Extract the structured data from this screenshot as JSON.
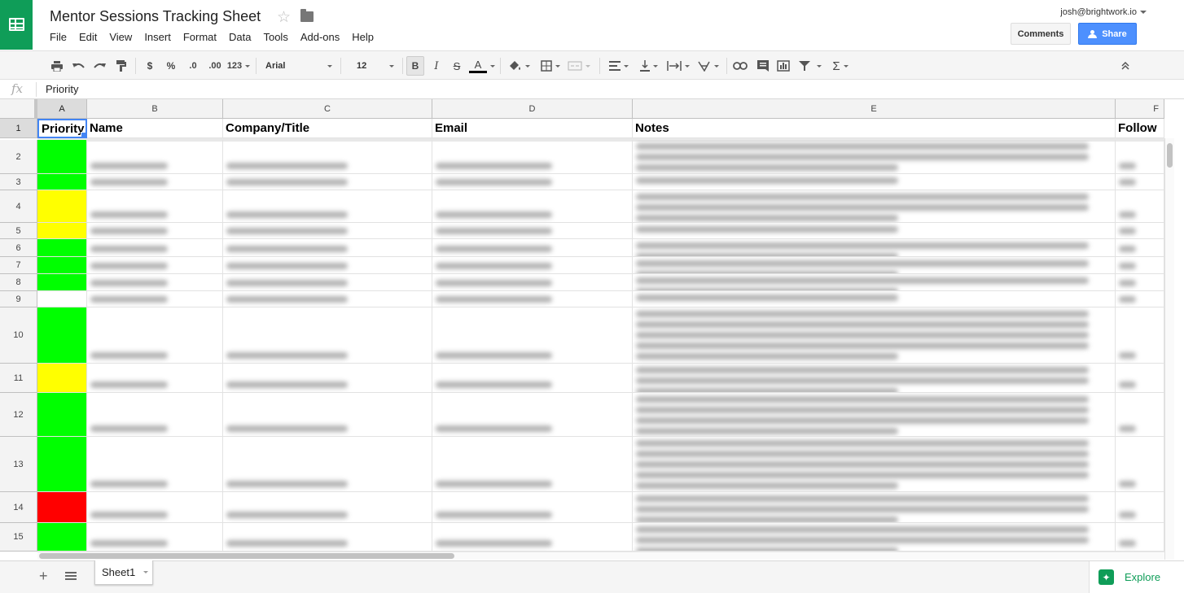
{
  "app": {
    "title": "Mentor Sessions Tracking Sheet",
    "account_email": "josh@brightwork.io",
    "comments_label": "Comments",
    "share_label": "Share"
  },
  "menu": [
    "File",
    "Edit",
    "View",
    "Insert",
    "Format",
    "Data",
    "Tools",
    "Add-ons",
    "Help"
  ],
  "toolbar": {
    "currency": "$",
    "percent": "%",
    "decimal_decrease": ".0",
    "decimal_increase": ".00",
    "more_formats": "123",
    "font": "Arial",
    "font_size": "12",
    "bold": "B",
    "italic": "I",
    "strikethrough": "S",
    "text_color": "A",
    "functions": "Σ"
  },
  "formula_bar": {
    "fx": "fx",
    "value": "Priority"
  },
  "columns": [
    "A",
    "B",
    "C",
    "D",
    "E",
    "F"
  ],
  "header_row": [
    "Priority",
    "Name",
    "Company/Title",
    "Email",
    "Notes",
    "Follow"
  ],
  "row_numbers": [
    "1",
    "2",
    "3",
    "4",
    "5",
    "6",
    "7",
    "8",
    "9",
    "10",
    "11",
    "12",
    "13",
    "14",
    "15"
  ],
  "priority_colors": {
    "green": "#00ff00",
    "yellow": "#ffff00",
    "red": "#ff0000",
    "none": "#ffffff"
  },
  "rows": [
    {
      "priority": "green"
    },
    {
      "priority": "green"
    },
    {
      "priority": "yellow"
    },
    {
      "priority": "yellow"
    },
    {
      "priority": "green"
    },
    {
      "priority": "green"
    },
    {
      "priority": "green"
    },
    {
      "priority": "none"
    },
    {
      "priority": "green"
    },
    {
      "priority": "yellow"
    },
    {
      "priority": "green"
    },
    {
      "priority": "green"
    },
    {
      "priority": "red"
    },
    {
      "priority": "green"
    }
  ],
  "sheet_tab": "Sheet1",
  "explore_label": "Explore",
  "colors": {
    "brand_green": "#0f9d58",
    "share_blue": "#4d90fe",
    "selection_blue": "#4285f4"
  }
}
